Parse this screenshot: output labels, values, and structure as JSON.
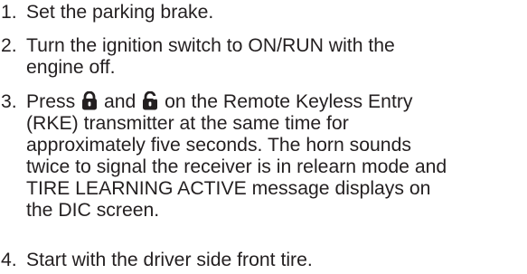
{
  "steps": [
    {
      "number": "1.",
      "lines": [
        "Set the parking brake."
      ]
    },
    {
      "number": "2.",
      "lines": [
        "Turn the ignition switch to ON/RUN with the",
        "engine off."
      ]
    },
    {
      "number": "3.",
      "line1_before": "Press",
      "line1_middle": "and",
      "line1_after": "on the Remote Keyless Entry",
      "icons": [
        "lock-icon",
        "unlock-icon"
      ],
      "lines": [
        "(RKE) transmitter at the same time for",
        "approximately five seconds. The horn sounds",
        "twice to signal the receiver is in relearn mode and",
        "TIRE LEARNING ACTIVE message displays on",
        "the DIC screen."
      ]
    },
    {
      "number": "4.",
      "lines": [
        "Start with the driver side front tire."
      ]
    }
  ],
  "colors": {
    "text": "#231f20"
  }
}
